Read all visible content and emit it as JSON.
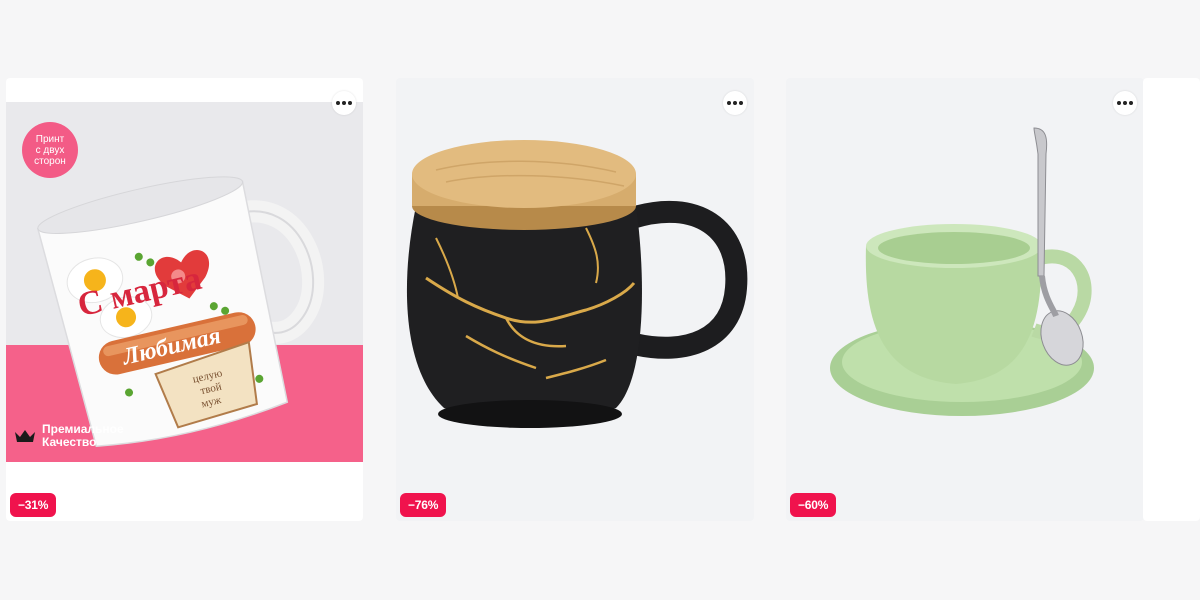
{
  "products": [
    {
      "name": "mug-march-8",
      "discount": "−31%",
      "promo": {
        "print_badge": [
          "Принт",
          "с двух",
          "сторон"
        ],
        "premium_lines": [
          "Премиальное",
          "Качество"
        ],
        "mug_text_top": "С марта",
        "mug_text_main": "Любимая",
        "mug_text_toast": [
          "целую",
          "твой",
          "муж"
        ]
      }
    },
    {
      "name": "black-marble-mug-bamboo-lid",
      "discount": "−76%"
    },
    {
      "name": "green-cup-saucer-spoon",
      "discount": "−60%"
    }
  ],
  "colors": {
    "badge": "#f0134d",
    "promo_pink": "#f5618a",
    "card_bg": "#f2f3f5"
  },
  "icons": [
    "more-options-icon",
    "crown-icon"
  ]
}
